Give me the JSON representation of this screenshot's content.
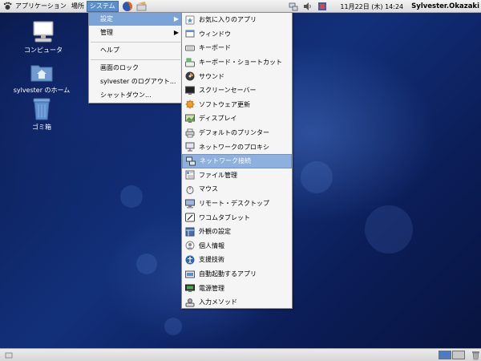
{
  "top_panel": {
    "menus": [
      "アプリケーション",
      "場所",
      "システム"
    ],
    "clock": "11月22日 (木) 14:24",
    "user": "Sylvester.Okazaki"
  },
  "desktop_icons": [
    {
      "label": "コンピュータ"
    },
    {
      "label": "sylvester のホーム"
    },
    {
      "label": "ゴミ箱"
    }
  ],
  "system_menu": {
    "items": [
      "設定",
      "管理",
      "ヘルプ",
      "画面のロック",
      "sylvester のログアウト...",
      "シャットダウン..."
    ],
    "highlighted": "設定"
  },
  "settings_menu": {
    "items": [
      "お気に入りのアプリ",
      "ウィンドウ",
      "キーボード",
      "キーボード・ショートカット",
      "サウンド",
      "スクリーンセーバー",
      "ソフトウェア更新",
      "ディスプレイ",
      "デフォルトのプリンター",
      "ネットワークのプロキシ",
      "ネットワーク接続",
      "ファイル管理",
      "マウス",
      "リモート・デスクトップ",
      "ワコムタブレット",
      "外観の設定",
      "個人情報",
      "支援技術",
      "自動起動するアプリ",
      "電源管理",
      "入力メソッド"
    ],
    "highlighted": "ネットワーク接続"
  },
  "colors": {
    "menu_highlight": "#8eb0dc",
    "panel": "#e4e4e4",
    "desktop": "#12307a"
  }
}
